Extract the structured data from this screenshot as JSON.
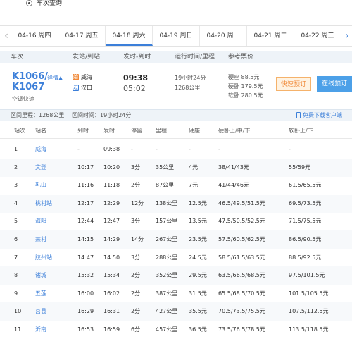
{
  "search_mode": {
    "label": "车次查询"
  },
  "dates": [
    {
      "label": "04-16 周四"
    },
    {
      "label": "04-17 周五"
    },
    {
      "label": "04-18 周六"
    },
    {
      "label": "04-19 周日"
    },
    {
      "label": "04-20 周一"
    },
    {
      "label": "04-21 周二"
    },
    {
      "label": "04-22 周三"
    }
  ],
  "active_date_index": 2,
  "arrows": {
    "left": "‹",
    "right": "›"
  },
  "train_header": {
    "train": "车次",
    "stations": "发站/到站",
    "times": "发时-到时",
    "duration": "运行时间/里程",
    "price": "参考票价"
  },
  "train": {
    "code1": "K1066/",
    "code2": "K1067",
    "detail_link": "详情▲",
    "type": "空调快速",
    "from_station": "威海",
    "to_station": "汉口",
    "from_icon": "始",
    "to_icon": "过",
    "depart": "09:38",
    "arrive": "05:02",
    "duration": "19小时24分",
    "mileage": "1268公里",
    "price_hard_seat": "硬座 88.5元",
    "price_hard_sleeper": "硬卧 179.5元",
    "price_soft_sleeper": "软卧 280.5元",
    "book_label": "快速预订",
    "online_label": "在线预订"
  },
  "stops_bar": {
    "mileage": "区间里程：1268公里",
    "runtime": "区间时间：19小时24分",
    "app_link": "免费下载客户端"
  },
  "stop_columns": {
    "no": "站次",
    "name": "站名",
    "arrive": "到时",
    "depart": "发时",
    "stay": "停留",
    "mileage": "里程",
    "hard_seat": "硬座",
    "hard_sleeper": "硬卧上/中/下",
    "soft_sleeper": "软卧上/下"
  },
  "stops": [
    {
      "no": "1",
      "name": "威海",
      "arrive": "-",
      "depart": "09:38",
      "stay": "-",
      "mileage": "-",
      "hard_seat": "-",
      "hard_sleeper": "-",
      "soft_sleeper": "-"
    },
    {
      "no": "2",
      "name": "文登",
      "arrive": "10:17",
      "depart": "10:20",
      "stay": "3分",
      "mileage": "35公里",
      "hard_seat": "4元",
      "hard_sleeper": "38/41/43元",
      "soft_sleeper": "55/59元"
    },
    {
      "no": "3",
      "name": "乳山",
      "arrive": "11:16",
      "depart": "11:18",
      "stay": "2分",
      "mileage": "87公里",
      "hard_seat": "7元",
      "hard_sleeper": "41/44/46元",
      "soft_sleeper": "61.5/65.5元"
    },
    {
      "no": "4",
      "name": "桃村站",
      "arrive": "12:17",
      "depart": "12:29",
      "stay": "12分",
      "mileage": "138公里",
      "hard_seat": "12.5元",
      "hard_sleeper": "46.5/49.5/51.5元",
      "soft_sleeper": "69.5/73.5元"
    },
    {
      "no": "5",
      "name": "海阳",
      "arrive": "12:44",
      "depart": "12:47",
      "stay": "3分",
      "mileage": "157公里",
      "hard_seat": "13.5元",
      "hard_sleeper": "47.5/50.5/52.5元",
      "soft_sleeper": "71.5/75.5元"
    },
    {
      "no": "6",
      "name": "莱村",
      "arrive": "14:15",
      "depart": "14:29",
      "stay": "14分",
      "mileage": "267公里",
      "hard_seat": "23.5元",
      "hard_sleeper": "57.5/60.5/62.5元",
      "soft_sleeper": "86.5/90.5元"
    },
    {
      "no": "7",
      "name": "胶州站",
      "arrive": "14:47",
      "depart": "14:50",
      "stay": "3分",
      "mileage": "288公里",
      "hard_seat": "24.5元",
      "hard_sleeper": "58.5/61.5/63.5元",
      "soft_sleeper": "88.5/92.5元"
    },
    {
      "no": "8",
      "name": "诸城",
      "arrive": "15:32",
      "depart": "15:34",
      "stay": "2分",
      "mileage": "352公里",
      "hard_seat": "29.5元",
      "hard_sleeper": "63.5/66.5/68.5元",
      "soft_sleeper": "97.5/101.5元"
    },
    {
      "no": "9",
      "name": "五莲",
      "arrive": "16:00",
      "depart": "16:02",
      "stay": "2分",
      "mileage": "387公里",
      "hard_seat": "31.5元",
      "hard_sleeper": "65.5/68.5/70.5元",
      "soft_sleeper": "101.5/105.5元"
    },
    {
      "no": "10",
      "name": "莒县",
      "arrive": "16:29",
      "depart": "16:31",
      "stay": "2分",
      "mileage": "427公里",
      "hard_seat": "35.5元",
      "hard_sleeper": "70.5/73.5/75.5元",
      "soft_sleeper": "107.5/112.5元"
    },
    {
      "no": "11",
      "name": "沂南",
      "arrive": "16:53",
      "depart": "16:59",
      "stay": "6分",
      "mileage": "457公里",
      "hard_seat": "36.5元",
      "hard_sleeper": "73.5/76.5/78.5元",
      "soft_sleeper": "113.5/118.5元"
    }
  ]
}
